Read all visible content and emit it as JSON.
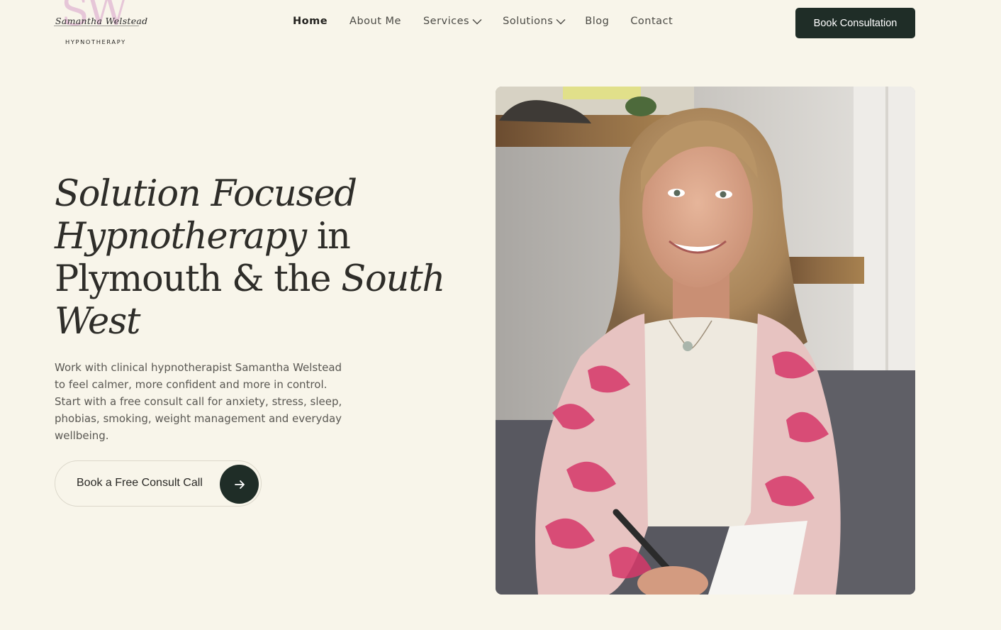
{
  "brand": {
    "monogram": "SW",
    "script_name": "Samantha Welstead",
    "subtitle": "HYPNOTHERAPY"
  },
  "nav": {
    "items": [
      {
        "label": "Home",
        "active": true,
        "has_dropdown": false
      },
      {
        "label": "About Me",
        "active": false,
        "has_dropdown": false
      },
      {
        "label": "Services",
        "active": false,
        "has_dropdown": true
      },
      {
        "label": "Solutions",
        "active": false,
        "has_dropdown": true
      },
      {
        "label": "Blog",
        "active": false,
        "has_dropdown": false
      },
      {
        "label": "Contact",
        "active": false,
        "has_dropdown": false
      }
    ],
    "cta_label": "Book Consultation"
  },
  "hero": {
    "title": {
      "part1": "Solution Focused",
      "part2": "Hypnotherapy",
      "part3": " in",
      "part4": "Plymouth & the ",
      "part5": "South",
      "part6": "West"
    },
    "description": "Work with clinical hypnotherapist Samantha Welstead to feel calmer, more confident and more in control. Start with a free consult call for anxiety, stress, sleep, phobias, smoking, weight management and everyday wellbeing.",
    "cta_label": "Book a Free Consult Call",
    "cta_icon": "arrow-right-icon"
  },
  "colors": {
    "background": "#f8f5ea",
    "primary_dark": "#1f2d27",
    "text": "#2e2d29",
    "logo_accent": "#e6c6d8"
  }
}
